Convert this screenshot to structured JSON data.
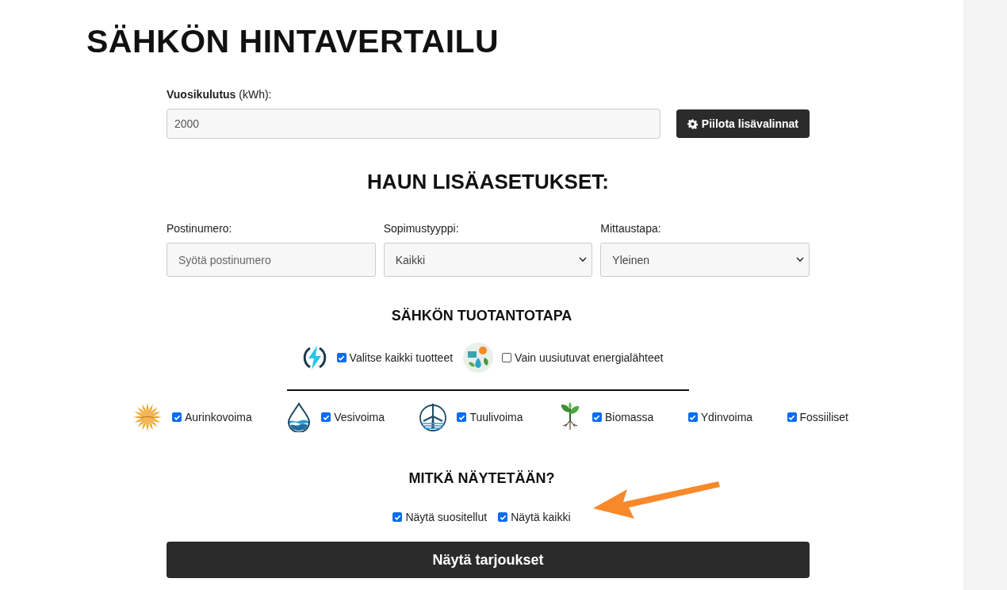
{
  "title": "SÄHKÖN HINTAVERTAILU",
  "consumption": {
    "label": "**Vuosikulutus** (kWh):",
    "value": "2000"
  },
  "toggle_button": {
    "label": "Piilota lisävalinnat"
  },
  "advanced": {
    "heading": "HAUN LISÄASETUKSET:",
    "fields": [
      {
        "kind": "input",
        "label": "Postinumero:",
        "placeholder": "Syötä postinumero"
      },
      {
        "kind": "select",
        "label": "Sopimustyyppi:",
        "value": "Kaikki"
      },
      {
        "kind": "select",
        "label": "Mittaustapa:",
        "value": "Yleinen"
      }
    ]
  },
  "production": {
    "heading": "SÄHKÖN TUOTANTOTAPA",
    "presets": [
      {
        "kind": "bolt",
        "label": "Valitse kaikki tuotteet",
        "checked": true
      },
      {
        "kind": "renewables",
        "label": "Vain uusiutuvat energialähteet",
        "checked": false
      }
    ],
    "sources": [
      {
        "kind": "sun",
        "label": "Aurinkovoima",
        "checked": true
      },
      {
        "kind": "water",
        "label": "Vesivoima",
        "checked": true
      },
      {
        "kind": "wind",
        "label": "Tuulivoima",
        "checked": true
      },
      {
        "kind": "plant",
        "label": "Biomassa",
        "checked": true
      },
      {
        "kind": "plain",
        "label": "Ydinvoima",
        "checked": true
      },
      {
        "kind": "plain",
        "label": "Fossiiliset",
        "checked": true
      }
    ]
  },
  "display": {
    "heading": "MITKÄ NÄYTETÄÄN?",
    "options": [
      {
        "label": "Näytä suositellut",
        "checked": true
      },
      {
        "label": "Näytä kaikki",
        "checked": true
      }
    ]
  },
  "submit_button": {
    "label": "Näytä tarjoukset"
  }
}
